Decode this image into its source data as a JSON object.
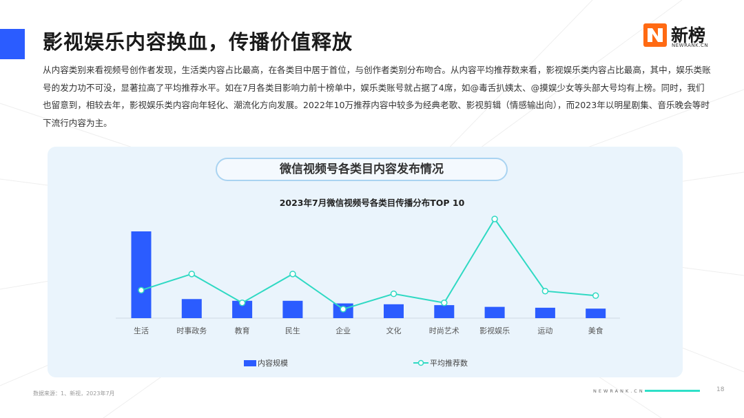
{
  "header": {
    "title": "影视娱乐内容换血，传播价值释放",
    "logo_cn": "新榜",
    "logo_en": "NEWRANK.CN"
  },
  "paragraph": "从内容类别来看视频号创作者发现，生活类内容占比最高，在各类目中居于首位，与创作者类别分布吻合。从内容平均推荐数来看，影视娱乐类内容占比最高，其中，娱乐类账号的发力功不可没，显著拉高了平均推荐水平。如在7月各类目影响力前十榜单中，娱乐类账号就占据了4席，如@毒舌扒姨太、@摸娱少女等头部大号均有上榜。同时，我们也留意到，相较去年，影视娱乐类内容向年轻化、潮流化方向发展。2022年10万推荐内容中较多为经典老歌、影视剪辑（情感输出向），而2023年以明星剧集、音乐晚会等时下流行内容为主。",
  "panel": {
    "pill_title": "微信视频号各类目内容发布情况"
  },
  "chart_data": {
    "type": "bar",
    "title": "2023年7月微信视频号各类目传播分布TOP 10",
    "categories": [
      "生活",
      "时事政务",
      "教育",
      "民生",
      "企业",
      "文化",
      "时尚艺术",
      "影视娱乐",
      "运动",
      "美食"
    ],
    "series": [
      {
        "name": "内容规模",
        "kind": "bar",
        "values": [
          100,
          22,
          20,
          20,
          17,
          16,
          15,
          13,
          12,
          11
        ]
      },
      {
        "name": "平均推荐数",
        "kind": "line",
        "values": [
          31,
          49,
          17,
          49,
          10,
          27,
          17,
          110,
          30,
          25
        ]
      }
    ],
    "legend_position": "bottom",
    "grid": false,
    "colors": {
      "bar": "#2b5cff",
      "line": "#2fd9c3"
    }
  },
  "footer": {
    "source": "数据来源：1、新视，2023年7月",
    "brand": "NEWRANK.CN",
    "page": "18"
  }
}
